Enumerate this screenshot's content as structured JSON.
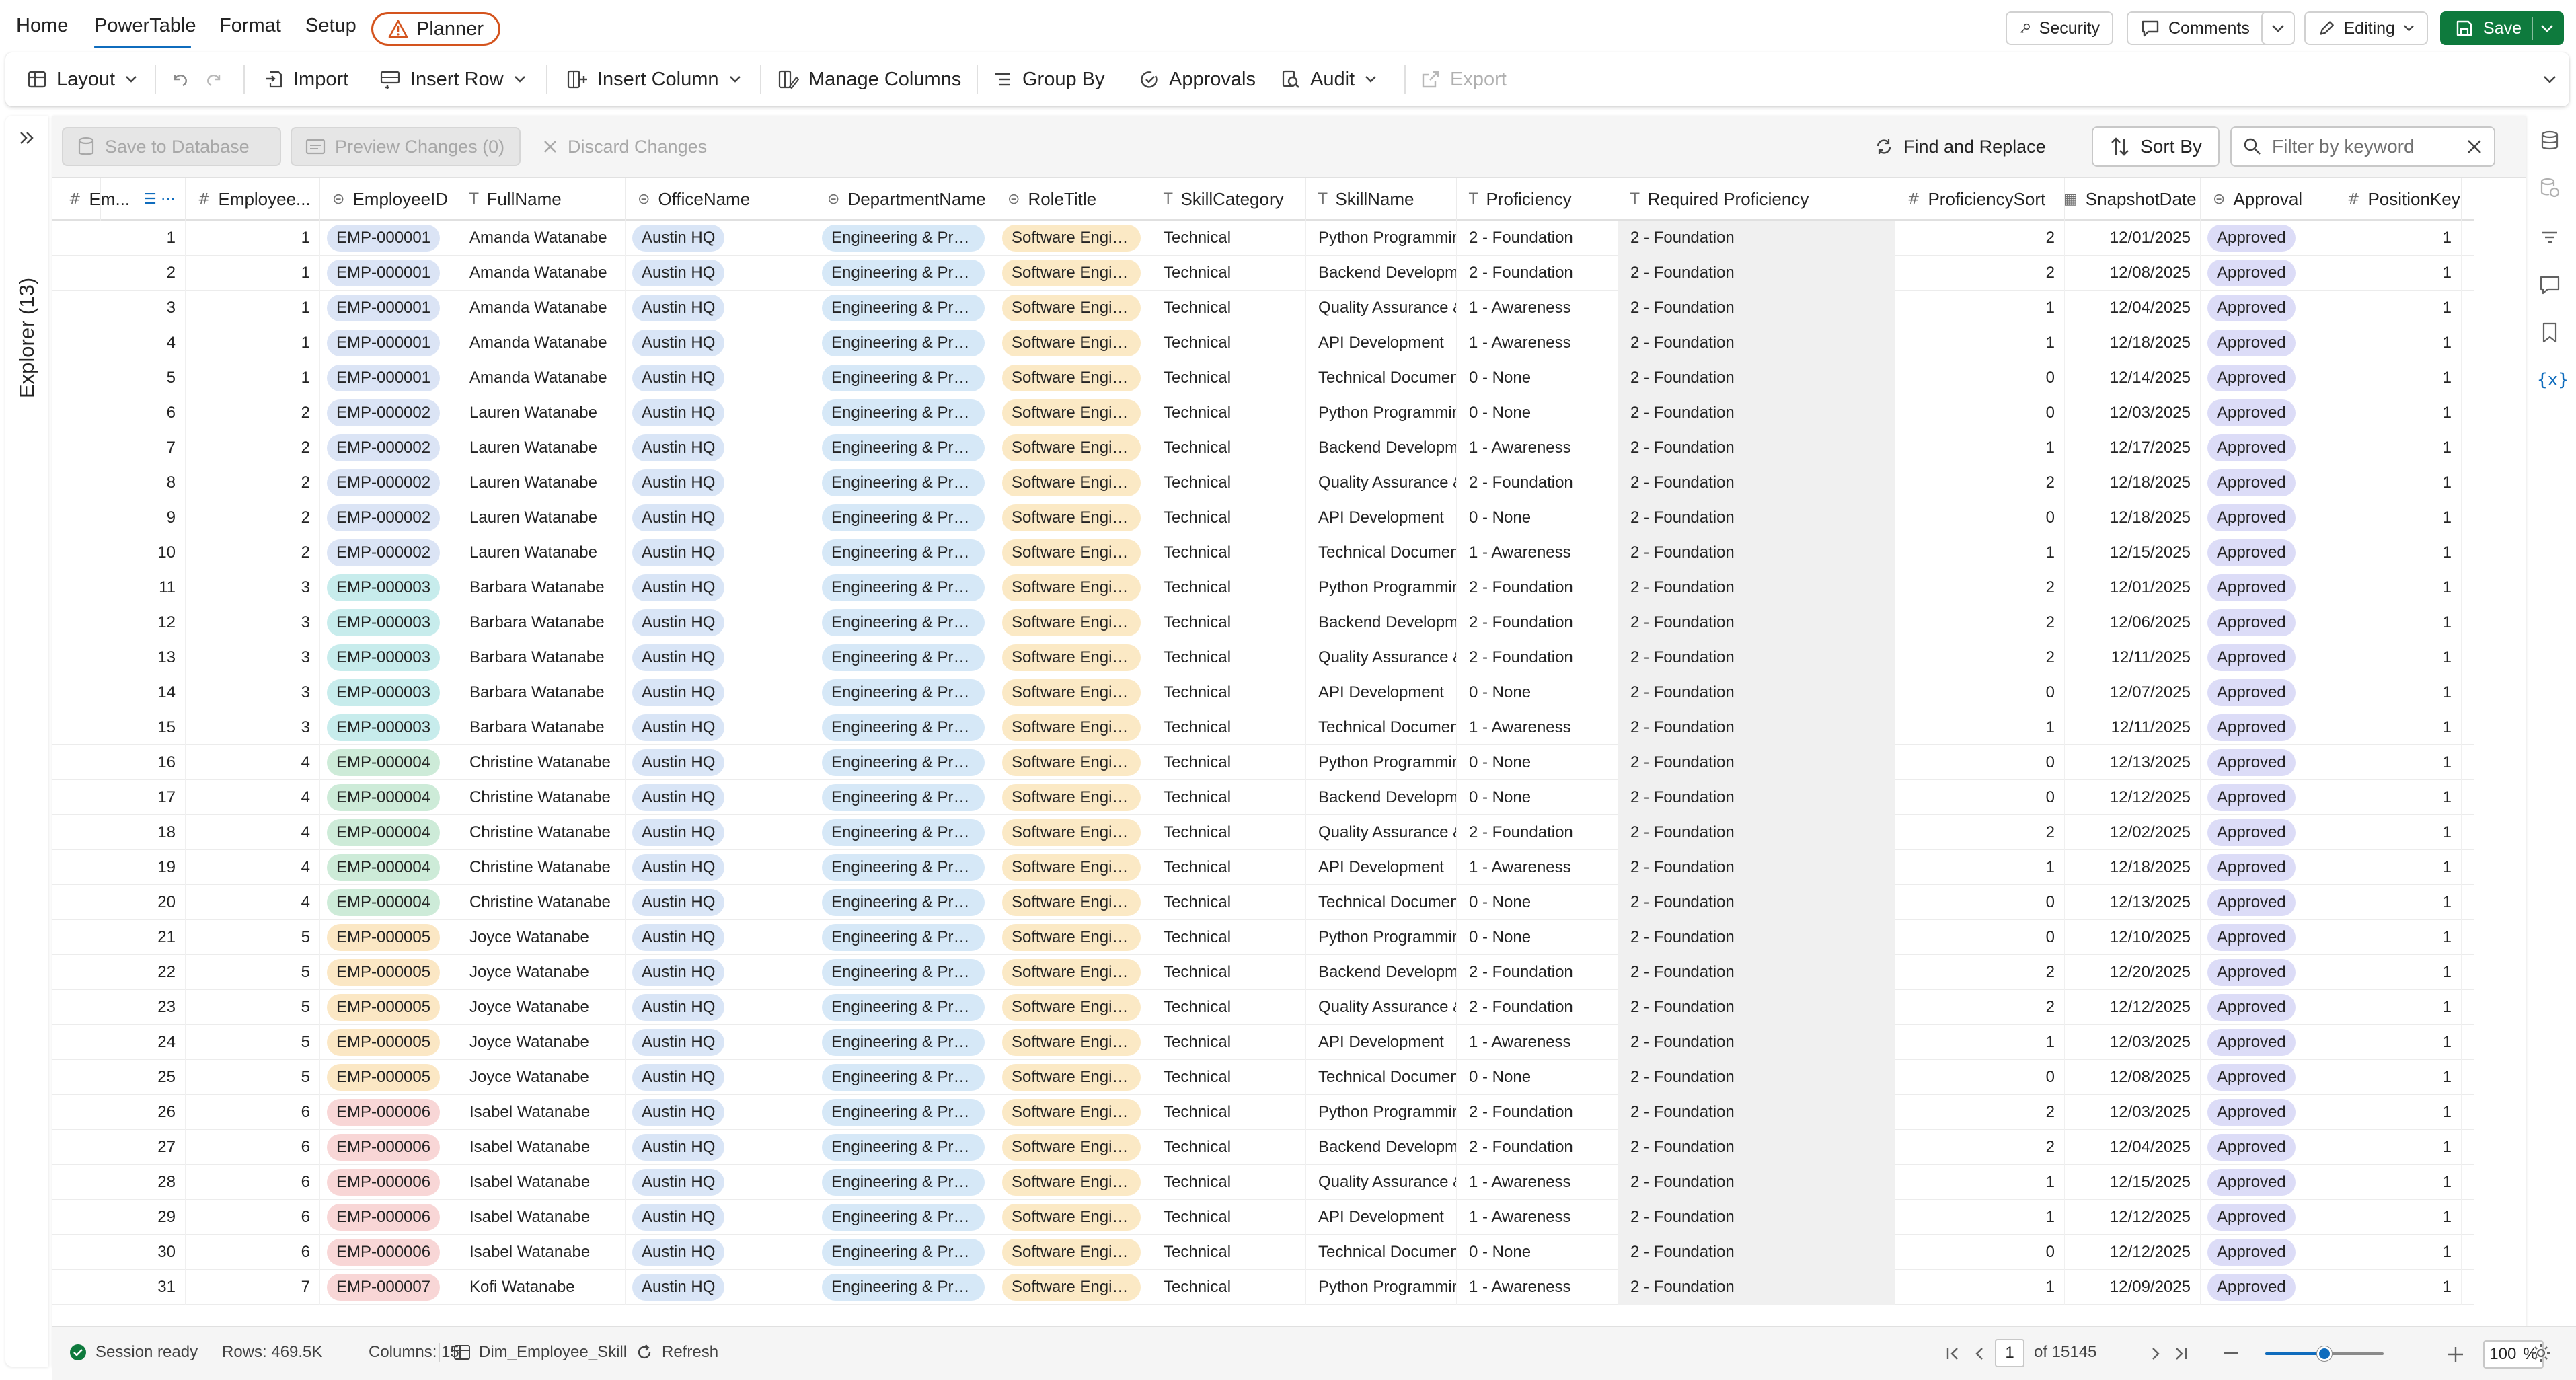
{
  "menu": {
    "items": [
      "Home",
      "PowerTable",
      "Format",
      "Setup"
    ],
    "planner_label": "Planner",
    "security_label": "Security",
    "comments_label": "Comments",
    "editing_label": "Editing",
    "save_label": "Save"
  },
  "ribbon": {
    "layout": "Layout",
    "import": "Import",
    "insert_row": "Insert Row",
    "insert_column": "Insert Column",
    "manage_columns": "Manage Columns",
    "group_by": "Group By",
    "approvals": "Approvals",
    "audit": "Audit",
    "export": "Export"
  },
  "explorer": {
    "label": "Explorer (13)"
  },
  "actionbar": {
    "save_db": "Save to Database",
    "preview": "Preview Changes (0)",
    "discard": "Discard Changes",
    "find_replace": "Find and Replace",
    "sort_by": "Sort By",
    "filter_placeholder": "Filter by keyword"
  },
  "columns": [
    {
      "label": "Em...",
      "type": "#"
    },
    {
      "label": "Employee...",
      "type": "#"
    },
    {
      "label": "EmployeeID",
      "type": "⊝"
    },
    {
      "label": "FullName",
      "type": "T"
    },
    {
      "label": "OfficeName",
      "type": "⊝"
    },
    {
      "label": "DepartmentName",
      "type": "⊝"
    },
    {
      "label": "RoleTitle",
      "type": "⊝"
    },
    {
      "label": "SkillCategory",
      "type": "T"
    },
    {
      "label": "SkillName",
      "type": "T"
    },
    {
      "label": "Proficiency",
      "type": "T"
    },
    {
      "label": "Required Proficiency",
      "type": "T"
    },
    {
      "label": "ProficiencySort",
      "type": "#"
    },
    {
      "label": "SnapshotDate",
      "type": "▦"
    },
    {
      "label": "Approval",
      "type": "⊝"
    },
    {
      "label": "PositionKey",
      "type": "#"
    }
  ],
  "rows": [
    {
      "n": 1,
      "emp": 1,
      "id": "EMP-000001",
      "name": "Amanda Watanabe",
      "office": "Austin HQ",
      "dept": "Engineering & Prod...",
      "role": "Software Engine...",
      "cat": "Technical",
      "skill": "Python Programming",
      "prof": "2 - Foundation",
      "req": "2 - Foundation",
      "sort": 2,
      "date": "12/01/2025",
      "appr": "Approved",
      "pos": 1
    },
    {
      "n": 2,
      "emp": 1,
      "id": "EMP-000001",
      "name": "Amanda Watanabe",
      "office": "Austin HQ",
      "dept": "Engineering & Prod...",
      "role": "Software Engine...",
      "cat": "Technical",
      "skill": "Backend Development",
      "prof": "2 - Foundation",
      "req": "2 - Foundation",
      "sort": 2,
      "date": "12/08/2025",
      "appr": "Approved",
      "pos": 1
    },
    {
      "n": 3,
      "emp": 1,
      "id": "EMP-000001",
      "name": "Amanda Watanabe",
      "office": "Austin HQ",
      "dept": "Engineering & Prod...",
      "role": "Software Engine...",
      "cat": "Technical",
      "skill": "Quality Assurance & Testing",
      "prof": "1 - Awareness",
      "req": "2 - Foundation",
      "sort": 1,
      "date": "12/04/2025",
      "appr": "Approved",
      "pos": 1
    },
    {
      "n": 4,
      "emp": 1,
      "id": "EMP-000001",
      "name": "Amanda Watanabe",
      "office": "Austin HQ",
      "dept": "Engineering & Prod...",
      "role": "Software Engine...",
      "cat": "Technical",
      "skill": "API Development",
      "prof": "1 - Awareness",
      "req": "2 - Foundation",
      "sort": 1,
      "date": "12/18/2025",
      "appr": "Approved",
      "pos": 1
    },
    {
      "n": 5,
      "emp": 1,
      "id": "EMP-000001",
      "name": "Amanda Watanabe",
      "office": "Austin HQ",
      "dept": "Engineering & Prod...",
      "role": "Software Engine...",
      "cat": "Technical",
      "skill": "Technical Documentation",
      "prof": "0 - None",
      "req": "2 - Foundation",
      "sort": 0,
      "date": "12/14/2025",
      "appr": "Approved",
      "pos": 1
    },
    {
      "n": 6,
      "emp": 2,
      "id": "EMP-000002",
      "name": "Lauren Watanabe",
      "office": "Austin HQ",
      "dept": "Engineering & Prod...",
      "role": "Software Engine...",
      "cat": "Technical",
      "skill": "Python Programming",
      "prof": "0 - None",
      "req": "2 - Foundation",
      "sort": 0,
      "date": "12/03/2025",
      "appr": "Approved",
      "pos": 1
    },
    {
      "n": 7,
      "emp": 2,
      "id": "EMP-000002",
      "name": "Lauren Watanabe",
      "office": "Austin HQ",
      "dept": "Engineering & Prod...",
      "role": "Software Engine...",
      "cat": "Technical",
      "skill": "Backend Development",
      "prof": "1 - Awareness",
      "req": "2 - Foundation",
      "sort": 1,
      "date": "12/17/2025",
      "appr": "Approved",
      "pos": 1
    },
    {
      "n": 8,
      "emp": 2,
      "id": "EMP-000002",
      "name": "Lauren Watanabe",
      "office": "Austin HQ",
      "dept": "Engineering & Prod...",
      "role": "Software Engine...",
      "cat": "Technical",
      "skill": "Quality Assurance & Testing",
      "prof": "2 - Foundation",
      "req": "2 - Foundation",
      "sort": 2,
      "date": "12/18/2025",
      "appr": "Approved",
      "pos": 1
    },
    {
      "n": 9,
      "emp": 2,
      "id": "EMP-000002",
      "name": "Lauren Watanabe",
      "office": "Austin HQ",
      "dept": "Engineering & Prod...",
      "role": "Software Engine...",
      "cat": "Technical",
      "skill": "API Development",
      "prof": "0 - None",
      "req": "2 - Foundation",
      "sort": 0,
      "date": "12/18/2025",
      "appr": "Approved",
      "pos": 1
    },
    {
      "n": 10,
      "emp": 2,
      "id": "EMP-000002",
      "name": "Lauren Watanabe",
      "office": "Austin HQ",
      "dept": "Engineering & Prod...",
      "role": "Software Engine...",
      "cat": "Technical",
      "skill": "Technical Documentation",
      "prof": "1 - Awareness",
      "req": "2 - Foundation",
      "sort": 1,
      "date": "12/15/2025",
      "appr": "Approved",
      "pos": 1
    },
    {
      "n": 11,
      "emp": 3,
      "id": "EMP-000003",
      "name": "Barbara Watanabe",
      "office": "Austin HQ",
      "dept": "Engineering & Prod...",
      "role": "Software Engine...",
      "cat": "Technical",
      "skill": "Python Programming",
      "prof": "2 - Foundation",
      "req": "2 - Foundation",
      "sort": 2,
      "date": "12/01/2025",
      "appr": "Approved",
      "pos": 1
    },
    {
      "n": 12,
      "emp": 3,
      "id": "EMP-000003",
      "name": "Barbara Watanabe",
      "office": "Austin HQ",
      "dept": "Engineering & Prod...",
      "role": "Software Engine...",
      "cat": "Technical",
      "skill": "Backend Development",
      "prof": "2 - Foundation",
      "req": "2 - Foundation",
      "sort": 2,
      "date": "12/06/2025",
      "appr": "Approved",
      "pos": 1
    },
    {
      "n": 13,
      "emp": 3,
      "id": "EMP-000003",
      "name": "Barbara Watanabe",
      "office": "Austin HQ",
      "dept": "Engineering & Prod...",
      "role": "Software Engine...",
      "cat": "Technical",
      "skill": "Quality Assurance & Testing",
      "prof": "2 - Foundation",
      "req": "2 - Foundation",
      "sort": 2,
      "date": "12/11/2025",
      "appr": "Approved",
      "pos": 1
    },
    {
      "n": 14,
      "emp": 3,
      "id": "EMP-000003",
      "name": "Barbara Watanabe",
      "office": "Austin HQ",
      "dept": "Engineering & Prod...",
      "role": "Software Engine...",
      "cat": "Technical",
      "skill": "API Development",
      "prof": "0 - None",
      "req": "2 - Foundation",
      "sort": 0,
      "date": "12/07/2025",
      "appr": "Approved",
      "pos": 1
    },
    {
      "n": 15,
      "emp": 3,
      "id": "EMP-000003",
      "name": "Barbara Watanabe",
      "office": "Austin HQ",
      "dept": "Engineering & Prod...",
      "role": "Software Engine...",
      "cat": "Technical",
      "skill": "Technical Documentation",
      "prof": "1 - Awareness",
      "req": "2 - Foundation",
      "sort": 1,
      "date": "12/11/2025",
      "appr": "Approved",
      "pos": 1
    },
    {
      "n": 16,
      "emp": 4,
      "id": "EMP-000004",
      "name": "Christine Watanabe",
      "office": "Austin HQ",
      "dept": "Engineering & Prod...",
      "role": "Software Engine...",
      "cat": "Technical",
      "skill": "Python Programming",
      "prof": "0 - None",
      "req": "2 - Foundation",
      "sort": 0,
      "date": "12/13/2025",
      "appr": "Approved",
      "pos": 1
    },
    {
      "n": 17,
      "emp": 4,
      "id": "EMP-000004",
      "name": "Christine Watanabe",
      "office": "Austin HQ",
      "dept": "Engineering & Prod...",
      "role": "Software Engine...",
      "cat": "Technical",
      "skill": "Backend Development",
      "prof": "0 - None",
      "req": "2 - Foundation",
      "sort": 0,
      "date": "12/12/2025",
      "appr": "Approved",
      "pos": 1
    },
    {
      "n": 18,
      "emp": 4,
      "id": "EMP-000004",
      "name": "Christine Watanabe",
      "office": "Austin HQ",
      "dept": "Engineering & Prod...",
      "role": "Software Engine...",
      "cat": "Technical",
      "skill": "Quality Assurance & Testing",
      "prof": "2 - Foundation",
      "req": "2 - Foundation",
      "sort": 2,
      "date": "12/02/2025",
      "appr": "Approved",
      "pos": 1
    },
    {
      "n": 19,
      "emp": 4,
      "id": "EMP-000004",
      "name": "Christine Watanabe",
      "office": "Austin HQ",
      "dept": "Engineering & Prod...",
      "role": "Software Engine...",
      "cat": "Technical",
      "skill": "API Development",
      "prof": "1 - Awareness",
      "req": "2 - Foundation",
      "sort": 1,
      "date": "12/18/2025",
      "appr": "Approved",
      "pos": 1
    },
    {
      "n": 20,
      "emp": 4,
      "id": "EMP-000004",
      "name": "Christine Watanabe",
      "office": "Austin HQ",
      "dept": "Engineering & Prod...",
      "role": "Software Engine...",
      "cat": "Technical",
      "skill": "Technical Documentation",
      "prof": "0 - None",
      "req": "2 - Foundation",
      "sort": 0,
      "date": "12/13/2025",
      "appr": "Approved",
      "pos": 1
    },
    {
      "n": 21,
      "emp": 5,
      "id": "EMP-000005",
      "name": "Joyce Watanabe",
      "office": "Austin HQ",
      "dept": "Engineering & Prod...",
      "role": "Software Engine...",
      "cat": "Technical",
      "skill": "Python Programming",
      "prof": "0 - None",
      "req": "2 - Foundation",
      "sort": 0,
      "date": "12/10/2025",
      "appr": "Approved",
      "pos": 1
    },
    {
      "n": 22,
      "emp": 5,
      "id": "EMP-000005",
      "name": "Joyce Watanabe",
      "office": "Austin HQ",
      "dept": "Engineering & Prod...",
      "role": "Software Engine...",
      "cat": "Technical",
      "skill": "Backend Development",
      "prof": "2 - Foundation",
      "req": "2 - Foundation",
      "sort": 2,
      "date": "12/20/2025",
      "appr": "Approved",
      "pos": 1
    },
    {
      "n": 23,
      "emp": 5,
      "id": "EMP-000005",
      "name": "Joyce Watanabe",
      "office": "Austin HQ",
      "dept": "Engineering & Prod...",
      "role": "Software Engine...",
      "cat": "Technical",
      "skill": "Quality Assurance & Testing",
      "prof": "2 - Foundation",
      "req": "2 - Foundation",
      "sort": 2,
      "date": "12/12/2025",
      "appr": "Approved",
      "pos": 1
    },
    {
      "n": 24,
      "emp": 5,
      "id": "EMP-000005",
      "name": "Joyce Watanabe",
      "office": "Austin HQ",
      "dept": "Engineering & Prod...",
      "role": "Software Engine...",
      "cat": "Technical",
      "skill": "API Development",
      "prof": "1 - Awareness",
      "req": "2 - Foundation",
      "sort": 1,
      "date": "12/03/2025",
      "appr": "Approved",
      "pos": 1
    },
    {
      "n": 25,
      "emp": 5,
      "id": "EMP-000005",
      "name": "Joyce Watanabe",
      "office": "Austin HQ",
      "dept": "Engineering & Prod...",
      "role": "Software Engine...",
      "cat": "Technical",
      "skill": "Technical Documentation",
      "prof": "0 - None",
      "req": "2 - Foundation",
      "sort": 0,
      "date": "12/08/2025",
      "appr": "Approved",
      "pos": 1
    },
    {
      "n": 26,
      "emp": 6,
      "id": "EMP-000006",
      "name": "Isabel Watanabe",
      "office": "Austin HQ",
      "dept": "Engineering & Prod...",
      "role": "Software Engine...",
      "cat": "Technical",
      "skill": "Python Programming",
      "prof": "2 - Foundation",
      "req": "2 - Foundation",
      "sort": 2,
      "date": "12/03/2025",
      "appr": "Approved",
      "pos": 1
    },
    {
      "n": 27,
      "emp": 6,
      "id": "EMP-000006",
      "name": "Isabel Watanabe",
      "office": "Austin HQ",
      "dept": "Engineering & Prod...",
      "role": "Software Engine...",
      "cat": "Technical",
      "skill": "Backend Development",
      "prof": "2 - Foundation",
      "req": "2 - Foundation",
      "sort": 2,
      "date": "12/04/2025",
      "appr": "Approved",
      "pos": 1
    },
    {
      "n": 28,
      "emp": 6,
      "id": "EMP-000006",
      "name": "Isabel Watanabe",
      "office": "Austin HQ",
      "dept": "Engineering & Prod...",
      "role": "Software Engine...",
      "cat": "Technical",
      "skill": "Quality Assurance & Testing",
      "prof": "1 - Awareness",
      "req": "2 - Foundation",
      "sort": 1,
      "date": "12/15/2025",
      "appr": "Approved",
      "pos": 1
    },
    {
      "n": 29,
      "emp": 6,
      "id": "EMP-000006",
      "name": "Isabel Watanabe",
      "office": "Austin HQ",
      "dept": "Engineering & Prod...",
      "role": "Software Engine...",
      "cat": "Technical",
      "skill": "API Development",
      "prof": "1 - Awareness",
      "req": "2 - Foundation",
      "sort": 1,
      "date": "12/12/2025",
      "appr": "Approved",
      "pos": 1
    },
    {
      "n": 30,
      "emp": 6,
      "id": "EMP-000006",
      "name": "Isabel Watanabe",
      "office": "Austin HQ",
      "dept": "Engineering & Prod...",
      "role": "Software Engine...",
      "cat": "Technical",
      "skill": "Technical Documentation",
      "prof": "0 - None",
      "req": "2 - Foundation",
      "sort": 0,
      "date": "12/12/2025",
      "appr": "Approved",
      "pos": 1
    },
    {
      "n": 31,
      "emp": 7,
      "id": "EMP-000007",
      "name": "Kofi Watanabe",
      "office": "Austin HQ",
      "dept": "Engineering & Prod...",
      "role": "Software Engine...",
      "cat": "Technical",
      "skill": "Python Programming",
      "prof": "1 - Awareness",
      "req": "2 - Foundation",
      "sort": 1,
      "date": "12/09/2025",
      "appr": "Approved",
      "pos": 1
    }
  ],
  "colors": {
    "emp_pills": {
      "EMP-000001": "#dbe4f5",
      "EMP-000002": "#dbe4f5",
      "EMP-000003": "#c7ecec",
      "EMP-000004": "#cdebd8",
      "EMP-000005": "#fbe7c4",
      "EMP-000006": "#f8d6d6",
      "EMP-000007": "#f8d6d6"
    },
    "office_pill": "#d9e5f6",
    "dept_pill": "#d6e8f7",
    "role_pill": "#fbe9c5",
    "approval_pill": "#dcdcf7",
    "save_green": "#0e7a3d",
    "planner_orange": "#d4541e",
    "accent_blue": "#0f6cbd"
  },
  "footer": {
    "status": "Session ready",
    "rows": "Rows: 469.5K",
    "columns": "Columns: 15",
    "table": "Dim_Employee_Skill",
    "refresh": "Refresh",
    "page": "1",
    "of_pages": "of 15145",
    "zoom": "100",
    "zoom_unit": "%",
    "zoom_level": 1.0
  }
}
